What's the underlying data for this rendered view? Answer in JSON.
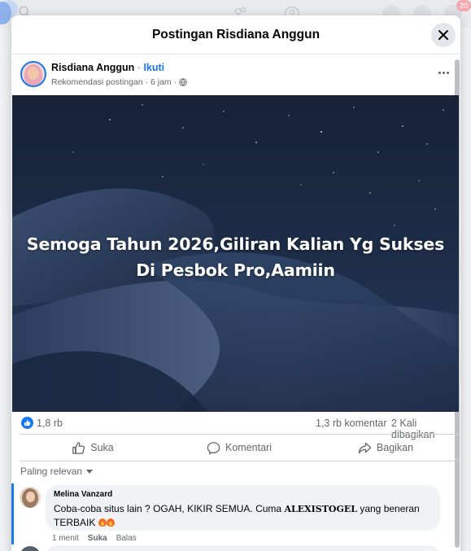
{
  "topbar": {
    "notification_badge": "20"
  },
  "modal": {
    "title": "Postingan Risdiana Anggun"
  },
  "post": {
    "author": "Risdiana Anggun",
    "separator": " · ",
    "follow_label": "Ikuti",
    "meta": "Rekomendasi postingan · 6 jam ·",
    "image_caption_line1": "Semoga Tahun 2026,Giliran Kalian Yg Sukses",
    "image_caption_line2": "Di Pesbok Pro,Aamiin",
    "likes": "1,8 rb",
    "comments": "1,3 rb komentar",
    "shares": "2 Kali dibagikan"
  },
  "actions": {
    "like_label": "Suka",
    "comment_label": "Komentari",
    "share_label": "Bagikan"
  },
  "comments_sort": {
    "label": "Paling relevan"
  },
  "comments": [
    {
      "author": "Melina Vanzard",
      "text_before": "Coba-coba situs lain ? OGAH, KIKIR SEMUA. Cuma ",
      "text_bold": "ALEXISTOGEL",
      "text_after": " yang beneran TERBAIK ",
      "time": "1 menit",
      "like_label": "Suka",
      "reply_label": "Balas"
    }
  ],
  "colors": {
    "accent": "#1877f2",
    "text": "#050505",
    "secondary_text": "#65676b",
    "bubble": "#f0f2f5"
  },
  "icons": [
    "search-icon",
    "home-icon",
    "friends-icon",
    "groups-icon",
    "menu-grid-icon",
    "messenger-icon",
    "bell-icon",
    "close-icon",
    "globe-icon",
    "more-icon",
    "like-icon",
    "comment-icon",
    "share-icon",
    "chevron-down-icon",
    "fire-emoji-icon"
  ]
}
